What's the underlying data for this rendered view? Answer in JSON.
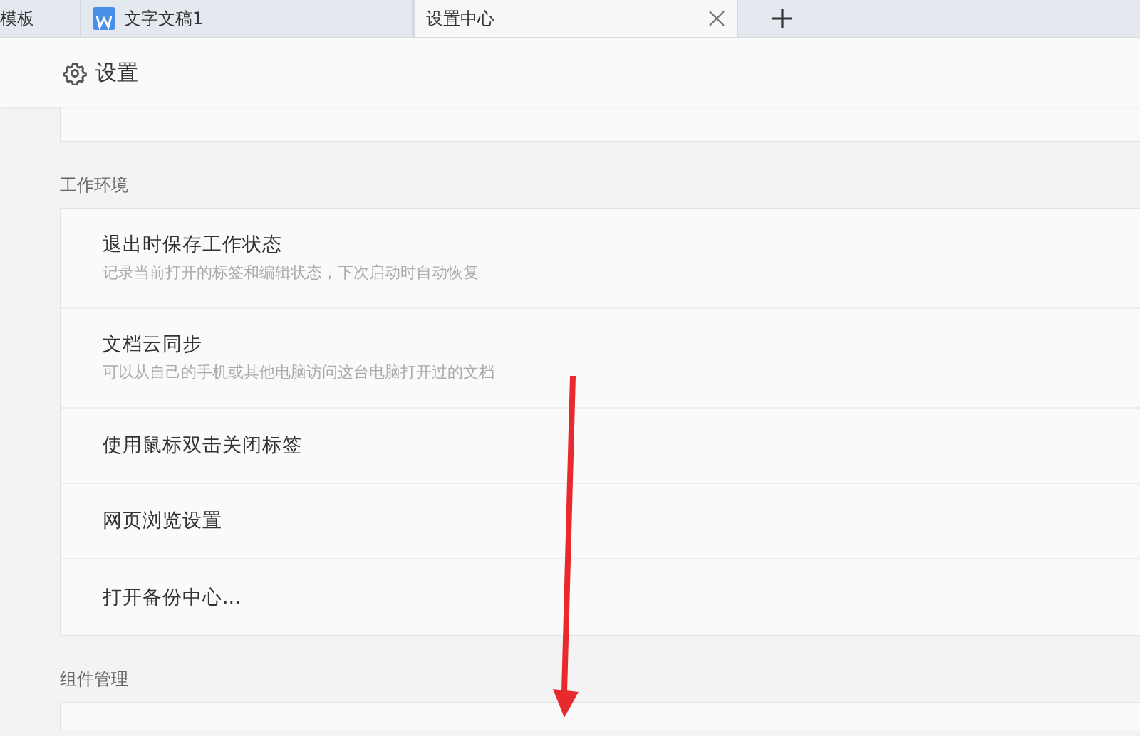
{
  "tabs": [
    {
      "label": "模板",
      "selected": false,
      "kind": "plain"
    },
    {
      "label": "文字文稿1",
      "selected": false,
      "kind": "document"
    },
    {
      "label": "设置中心",
      "selected": true,
      "kind": "plain"
    }
  ],
  "header": {
    "title": "设置"
  },
  "sections": [
    {
      "title": "工作环境",
      "items": [
        {
          "title": "退出时保存工作状态",
          "description": "记录当前打开的标签和编辑状态，下次启动时自动恢复"
        },
        {
          "title": "文档云同步",
          "description": "可以从自己的手机或其他电脑访问这台电脑打开过的文档"
        },
        {
          "title": "使用鼠标双击关闭标签"
        },
        {
          "title": "网页浏览设置"
        },
        {
          "title": "打开备份中心..."
        }
      ]
    },
    {
      "title": "组件管理"
    }
  ]
}
